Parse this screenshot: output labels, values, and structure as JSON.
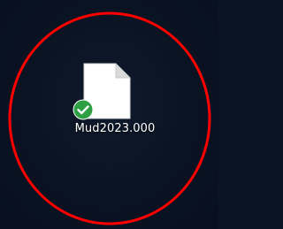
{
  "desktop": {
    "background_color": "#0b1424",
    "highlight_color": "#ff0000",
    "file": {
      "name": "Mud2023.000",
      "icon": "blank-document-icon",
      "status_icon": "sync-complete-check-icon",
      "status_color": "#2ea043"
    }
  }
}
